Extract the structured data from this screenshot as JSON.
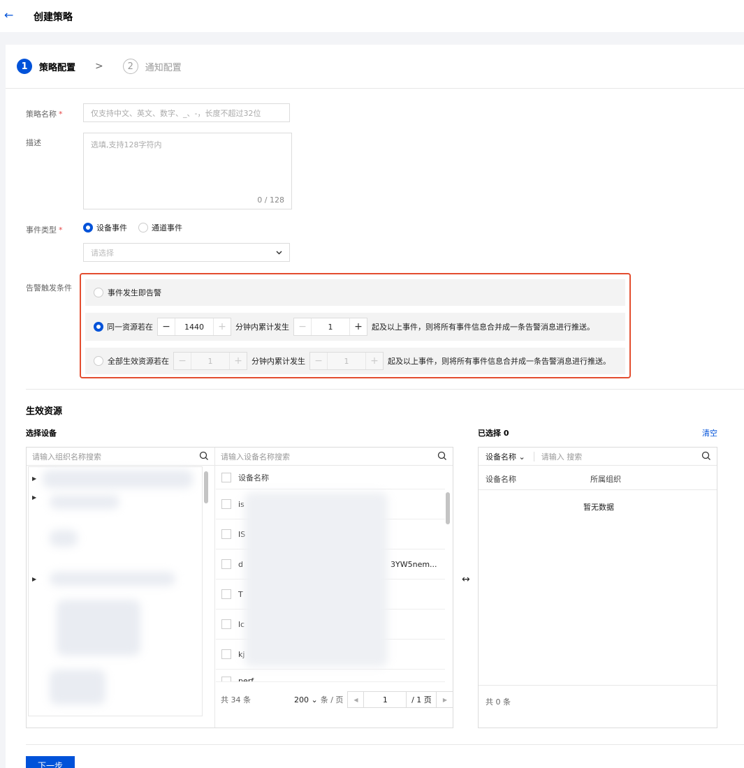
{
  "header": {
    "title": "创建策略",
    "back_icon": "arrow-left-icon"
  },
  "steps": [
    {
      "num": "1",
      "label": "策略配置"
    },
    {
      "num": "2",
      "label": "通知配置"
    }
  ],
  "form": {
    "name_label": "策略名称",
    "name_placeholder": "仅支持中文、英文、数字、_、-，长度不超过32位",
    "desc_label": "描述",
    "desc_placeholder": "选填,支持128字符内",
    "desc_counter": "0 / 128",
    "event_type_label": "事件类型",
    "event_options": [
      "设备事件",
      "通道事件"
    ],
    "event_select_placeholder": "请选择",
    "trigger_label": "告警触发条件",
    "trigger_opt1": "事件发生即告警",
    "trigger_opt2_prefix": "同一资源若在",
    "trigger_opt2_minutes": "1440",
    "trigger_opt2_mid": "分钟内累计发生",
    "trigger_opt2_count": "1",
    "trigger_opt2_suffix": "起及以上事件，则将所有事件信息合并成一条告警消息进行推送。",
    "trigger_opt3_prefix": "全部生效资源若在",
    "trigger_opt3_minutes": "1",
    "trigger_opt3_mid": "分钟内累计发生",
    "trigger_opt3_count": "1",
    "trigger_opt3_suffix": "起及以上事件，则将所有事件信息合并成一条告警消息进行推送。",
    "required_mark": "*"
  },
  "resources": {
    "section_title": "生效资源",
    "select_device_title": "选择设备",
    "org_search_placeholder": "请输入组织名称搜索",
    "device_search_placeholder": "请输入设备名称搜索",
    "device_name_header": "设备名称",
    "device_rows": [
      "is",
      "IS",
      "d",
      "T",
      "lc",
      "kj",
      "perf"
    ],
    "device_row3_tail": "3YW5nem...",
    "total": "共 34 条",
    "page_size": "200",
    "per_page": "条 / 页",
    "page": "1",
    "total_pages": "/ 1 页",
    "transfer_icon": "↔",
    "selected_title": "已选择 0",
    "clear": "清空",
    "filter_field": "设备名称",
    "selected_search_placeholder": "请输入 搜索",
    "col_device": "设备名称",
    "col_org": "所属组织",
    "empty": "暂无数据",
    "selected_total": "共 0 条"
  },
  "footer": {
    "next": "下一步"
  },
  "colors": {
    "primary": "#0052d9",
    "highlight_border": "#e34d2f"
  }
}
